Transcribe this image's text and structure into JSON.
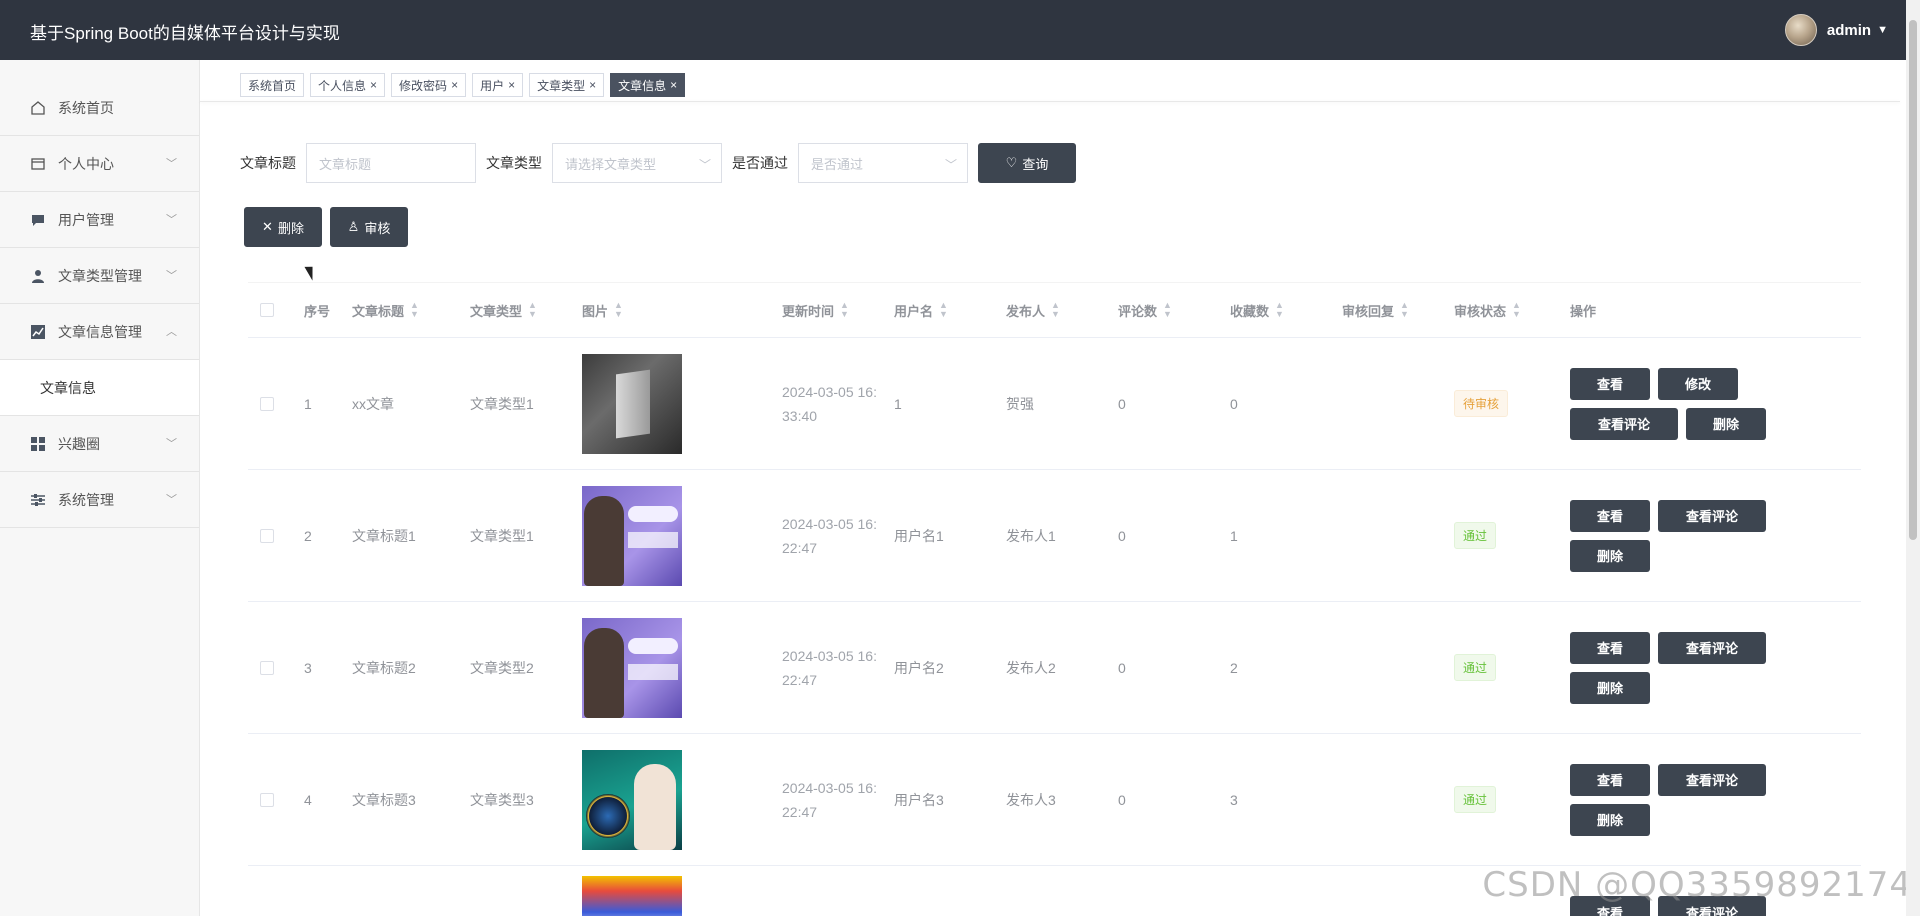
{
  "header": {
    "title": "基于Spring Boot的自媒体平台设计与实现",
    "username": "admin",
    "caret": "▼"
  },
  "sidebar": {
    "items": [
      {
        "label": "系统首页",
        "icon": "home-icon",
        "has_arrow": false
      },
      {
        "label": "个人中心",
        "icon": "profile-card-icon",
        "has_arrow": true
      },
      {
        "label": "用户管理",
        "icon": "chat-icon",
        "has_arrow": true
      },
      {
        "label": "文章类型管理",
        "icon": "person-icon",
        "has_arrow": true
      },
      {
        "label": "文章信息管理",
        "icon": "chart-icon",
        "has_arrow": true,
        "expanded": true
      },
      {
        "label": "兴趣圈",
        "icon": "grid-icon",
        "has_arrow": true
      },
      {
        "label": "系统管理",
        "icon": "sliders-icon",
        "has_arrow": true
      }
    ],
    "subitem": "文章信息"
  },
  "tags": [
    {
      "label": "系统首页",
      "closable": false,
      "active": false
    },
    {
      "label": "个人信息",
      "closable": true,
      "active": false
    },
    {
      "label": "修改密码",
      "closable": true,
      "active": false
    },
    {
      "label": "用户",
      "closable": true,
      "active": false
    },
    {
      "label": "文章类型",
      "closable": true,
      "active": false
    },
    {
      "label": "文章信息",
      "closable": true,
      "active": true
    }
  ],
  "search": {
    "title_label": "文章标题",
    "title_placeholder": "文章标题",
    "type_label": "文章类型",
    "type_placeholder": "请选择文章类型",
    "pass_label": "是否通过",
    "pass_placeholder": "是否通过",
    "query_button": "查询"
  },
  "actions": {
    "delete": "删除",
    "audit": "审核"
  },
  "table": {
    "headers": {
      "no": "序号",
      "title": "文章标题",
      "type": "文章类型",
      "image": "图片",
      "time": "更新时间",
      "user": "用户名",
      "publisher": "发布人",
      "comments": "评论数",
      "favorites": "收藏数",
      "reply": "审核回复",
      "status": "审核状态",
      "ops": "操作"
    },
    "rows": [
      {
        "no": "1",
        "title": "xx文章",
        "type": "文章类型1",
        "time": "2024-03-05 16:33:40",
        "user": "1",
        "publisher": "贺强",
        "comments": "0",
        "favorites": "0",
        "reply": "",
        "status": "待审核",
        "status_kind": "pending",
        "ops": [
          "查看",
          "修改",
          "查看评论",
          "删除"
        ]
      },
      {
        "no": "2",
        "title": "文章标题1",
        "type": "文章类型1",
        "time": "2024-03-05 16:22:47",
        "user": "用户名1",
        "publisher": "发布人1",
        "comments": "0",
        "favorites": "1",
        "reply": "",
        "status": "通过",
        "status_kind": "pass",
        "ops": [
          "查看",
          "查看评论",
          "删除"
        ]
      },
      {
        "no": "3",
        "title": "文章标题2",
        "type": "文章类型2",
        "time": "2024-03-05 16:22:47",
        "user": "用户名2",
        "publisher": "发布人2",
        "comments": "0",
        "favorites": "2",
        "reply": "",
        "status": "通过",
        "status_kind": "pass",
        "ops": [
          "查看",
          "查看评论",
          "删除"
        ]
      },
      {
        "no": "4",
        "title": "文章标题3",
        "type": "文章类型3",
        "time": "2024-03-05 16:22:47",
        "user": "用户名3",
        "publisher": "发布人3",
        "comments": "0",
        "favorites": "3",
        "reply": "",
        "status": "通过",
        "status_kind": "pass",
        "ops": [
          "查看",
          "查看评论",
          "删除"
        ]
      }
    ],
    "partial_row_ops": [
      "查看",
      "查看评论"
    ]
  },
  "watermark": "CSDN @QQ3359892174",
  "colors": {
    "header_bg": "#2f3540",
    "button_dark": "#3d4550",
    "pass": "#67c23a",
    "pending": "#e6a23c"
  }
}
